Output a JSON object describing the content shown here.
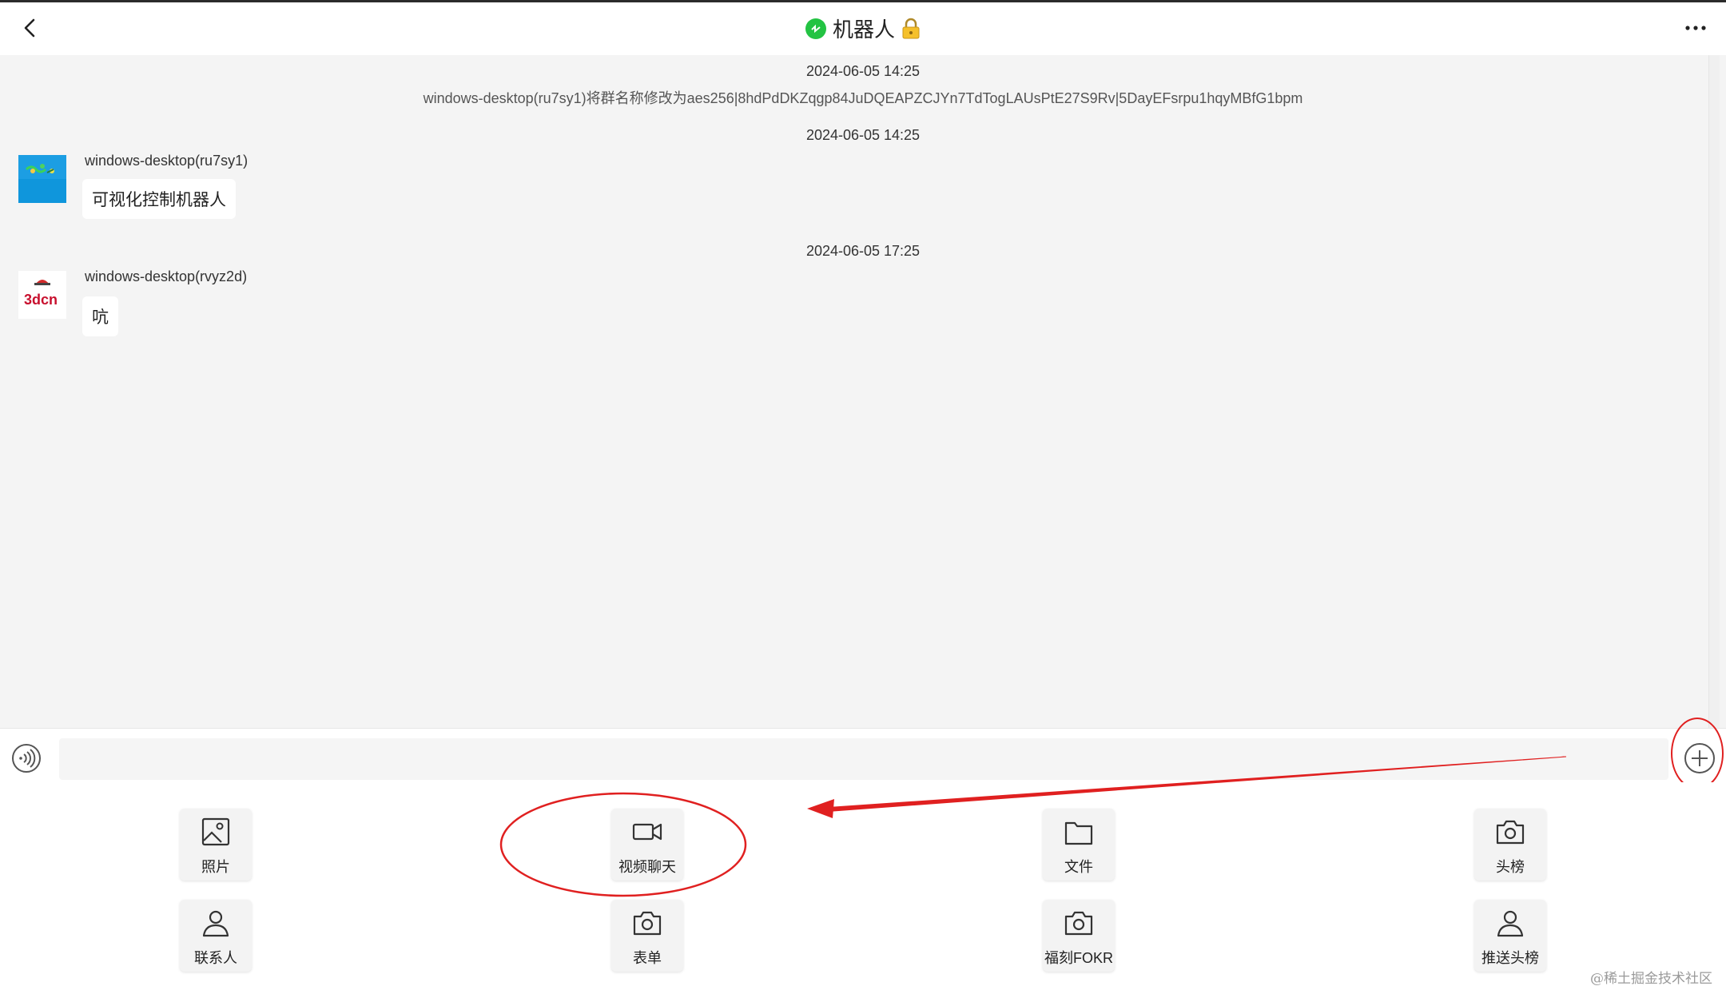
{
  "header": {
    "title": "机器人",
    "back_icon": "chevron-left-icon",
    "more_icon": "more-horizontal-icon",
    "status_icon": "green-status-icon",
    "lock_icon": "lock-icon"
  },
  "chat": {
    "timestamps": [
      "2024-06-05 14:25",
      "2024-06-05 14:25",
      "2024-06-05 17:25"
    ],
    "system_message": "windows-desktop(ru7sy1)将群名称修改为aes256|8hdPdDKZqgp84JuDQEAPZCJYn7TdTogLAUsPtE27S9Rv|5DayEFsrpu1hqyMBfG1bpm",
    "messages": [
      {
        "sender": "windows-desktop(ru7sy1)",
        "text": "可视化控制机器人"
      },
      {
        "sender": "windows-desktop(rvyz2d)",
        "text": "吭"
      }
    ],
    "avatar_2_text": "3dcn"
  },
  "input_bar": {
    "placeholder": "",
    "voice_icon": "voice-icon",
    "plus_icon": "plus-circle-icon"
  },
  "actions": [
    {
      "label": "照片",
      "icon": "image-icon"
    },
    {
      "label": "视频聊天",
      "icon": "video-camera-icon"
    },
    {
      "label": "文件",
      "icon": "folder-icon"
    },
    {
      "label": "头榜",
      "icon": "camera-icon"
    },
    {
      "label": "联系人",
      "icon": "user-icon"
    },
    {
      "label": "表单",
      "icon": "camera-icon"
    },
    {
      "label": "福刻FOKR",
      "icon": "camera-icon"
    },
    {
      "label": "推送头榜",
      "icon": "user-icon"
    }
  ],
  "annotation_color": "#e02020",
  "accent_green": "#23c343",
  "watermark": "@稀土掘金技术社区"
}
